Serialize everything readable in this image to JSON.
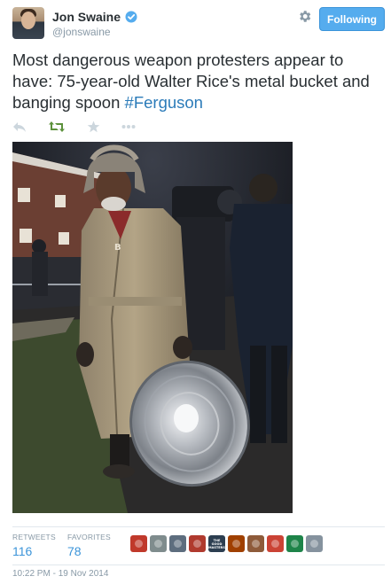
{
  "author": {
    "name": "Jon Swaine",
    "handle": "@jonswaine"
  },
  "follow_button_label": "Following",
  "tweet": {
    "text": "Most dangerous weapon protesters appear to have: 75-year-old Walter Rice's metal bucket and banging spoon ",
    "hashtag": "#Ferguson"
  },
  "actions": [
    "reply-icon",
    "retweet-icon",
    "favorite-icon",
    "more-icon"
  ],
  "photo": {
    "description_icon": "photo",
    "coat_sign": "B"
  },
  "stats": {
    "retweets_label": "RETWEETS",
    "retweets_value": "116",
    "favorites_label": "FAVORITES",
    "favorites_value": "78"
  },
  "favoriters": [
    {
      "color": "#c0392b"
    },
    {
      "color": "#7f8c8d"
    },
    {
      "color": "#5d6d7e"
    },
    {
      "color": "#b03a2e"
    },
    {
      "color": "#2c3e50",
      "text": "THE GOOD MASTERS"
    },
    {
      "color": "#a04000"
    },
    {
      "color": "#8e5b3a"
    },
    {
      "color": "#cb4335"
    },
    {
      "color": "#1e8449"
    },
    {
      "color": "#85929e"
    }
  ],
  "timestamp": "10:22 PM - 19 Nov 2014",
  "colors": {
    "link": "#2b7bb9",
    "accent": "#55acee",
    "muted": "#8899a6"
  }
}
